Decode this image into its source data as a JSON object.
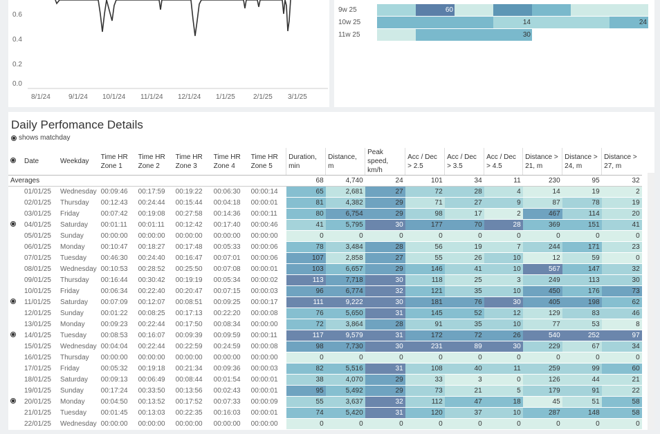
{
  "line_chart": {
    "y_ticks": [
      "0.6",
      "0.4",
      "0.2",
      "0.0"
    ],
    "x_ticks": [
      "8/1/24",
      "9/1/24",
      "10/1/24",
      "11/1/24",
      "12/1/24",
      "1/1/25",
      "2/1/25",
      "3/1/25"
    ]
  },
  "heatmap": {
    "rows": [
      {
        "label": "9w 25",
        "cells": [
          {
            "v": "",
            "c": "#a7d7dc"
          },
          {
            "v": "60",
            "c": "#5b7fa8",
            "w": true
          },
          {
            "v": "",
            "c": "#cfeae6"
          },
          {
            "v": "",
            "c": "#5d96b5"
          },
          {
            "v": "",
            "c": "#7ab9cc"
          },
          {
            "v": "",
            "c": "#cfeae6"
          },
          {
            "v": "",
            "c": "#cfeae6"
          }
        ]
      },
      {
        "label": "10w 25",
        "cells": [
          {
            "v": "",
            "c": "#7ab9cc"
          },
          {
            "v": "",
            "c": "#7ab9cc"
          },
          {
            "v": "",
            "c": "#7ab9cc"
          },
          {
            "v": "14",
            "c": "#a7d7dc"
          },
          {
            "v": "",
            "c": "#a7d7dc"
          },
          {
            "v": "",
            "c": "#a7d7dc"
          },
          {
            "v": "24",
            "c": "#7ab9cc"
          }
        ]
      },
      {
        "label": "11w 25",
        "cells": [
          {
            "v": "",
            "c": "#cfeae6"
          },
          {
            "v": "",
            "c": "#7ab9cc"
          },
          {
            "v": "",
            "c": "#7ab9cc"
          },
          {
            "v": "30",
            "c": "#7ab9cc"
          },
          {
            "v": "",
            "c": "#fff"
          },
          {
            "v": "",
            "c": "#fff"
          },
          {
            "v": "",
            "c": "#fff"
          }
        ]
      }
    ]
  },
  "details": {
    "title": "Daily Perfomance Details",
    "subtitle": "shows matchday",
    "headers": [
      "Date",
      "Weekday",
      "Time HR Zone 1",
      "Time HR Zone 2",
      "Time HR Zone 3",
      "Time HR Zone 4",
      "Time HR Zone 5",
      "Duration, min",
      "Distance, m",
      "Peak speed, km/h",
      "Acc / Dec > 2.5",
      "Acc / Dec > 3.5",
      "Acc / Dec > 4.5",
      "Distance > 21, m",
      "Distance > 24, m",
      "Distance > 27, m"
    ],
    "averages_label": "Averages",
    "averages": [
      "68",
      "4,740",
      "24",
      "101",
      "34",
      "11",
      "230",
      "95",
      "32"
    ],
    "rows": [
      {
        "m": false,
        "d": "01/01/25",
        "w": "Wednesday",
        "z": [
          "00:09:46",
          "00:17:59",
          "00:19:22",
          "00:06:30",
          "00:00:14"
        ],
        "n": [
          "65",
          "2,681",
          "27",
          "72",
          "28",
          "4",
          "14",
          "19",
          "2"
        ]
      },
      {
        "m": false,
        "d": "02/01/25",
        "w": "Thursday",
        "z": [
          "00:12:43",
          "00:24:44",
          "00:15:44",
          "00:04:18",
          "00:00:01"
        ],
        "n": [
          "81",
          "4,382",
          "29",
          "71",
          "27",
          "9",
          "87",
          "78",
          "19"
        ]
      },
      {
        "m": false,
        "d": "03/01/25",
        "w": "Friday",
        "z": [
          "00:07:42",
          "00:19:08",
          "00:27:58",
          "00:14:36",
          "00:00:11"
        ],
        "n": [
          "80",
          "6,754",
          "29",
          "98",
          "17",
          "2",
          "467",
          "114",
          "20"
        ]
      },
      {
        "m": true,
        "d": "04/01/25",
        "w": "Saturday",
        "z": [
          "00:01:11",
          "00:01:11",
          "00:12:42",
          "00:17:40",
          "00:00:46"
        ],
        "n": [
          "41",
          "5,795",
          "30",
          "177",
          "70",
          "28",
          "369",
          "151",
          "41"
        ]
      },
      {
        "m": false,
        "d": "05/01/25",
        "w": "Sunday",
        "z": [
          "00:00:00",
          "00:00:00",
          "00:00:00",
          "00:00:00",
          "00:00:00"
        ],
        "n": [
          "0",
          "0",
          "0",
          "0",
          "0",
          "0",
          "0",
          "0",
          "0"
        ]
      },
      {
        "m": false,
        "d": "06/01/25",
        "w": "Monday",
        "z": [
          "00:10:47",
          "00:18:27",
          "00:17:48",
          "00:05:33",
          "00:00:06"
        ],
        "n": [
          "78",
          "3,484",
          "28",
          "56",
          "19",
          "7",
          "244",
          "171",
          "23"
        ]
      },
      {
        "m": false,
        "d": "07/01/25",
        "w": "Tuesday",
        "z": [
          "00:46:30",
          "00:24:40",
          "00:16:47",
          "00:07:01",
          "00:00:06"
        ],
        "n": [
          "107",
          "2,858",
          "27",
          "55",
          "26",
          "10",
          "12",
          "59",
          "0"
        ]
      },
      {
        "m": false,
        "d": "08/01/25",
        "w": "Wednesday",
        "z": [
          "00:10:53",
          "00:28:52",
          "00:25:50",
          "00:07:08",
          "00:00:01"
        ],
        "n": [
          "103",
          "6,657",
          "29",
          "146",
          "41",
          "10",
          "567",
          "147",
          "32"
        ]
      },
      {
        "m": false,
        "d": "09/01/25",
        "w": "Thursday",
        "z": [
          "00:16:44",
          "00:30:42",
          "00:19:19",
          "00:05:34",
          "00:00:02"
        ],
        "n": [
          "113",
          "7,718",
          "30",
          "118",
          "25",
          "3",
          "249",
          "113",
          "30"
        ]
      },
      {
        "m": false,
        "d": "10/01/25",
        "w": "Friday",
        "z": [
          "00:06:34",
          "00:22:40",
          "00:20:47",
          "00:07:15",
          "00:00:03"
        ],
        "n": [
          "96",
          "6,774",
          "32",
          "121",
          "35",
          "10",
          "450",
          "176",
          "73"
        ]
      },
      {
        "m": true,
        "d": "11/01/25",
        "w": "Saturday",
        "z": [
          "00:07:09",
          "00:12:07",
          "00:08:51",
          "00:09:25",
          "00:00:17"
        ],
        "n": [
          "111",
          "9,222",
          "30",
          "181",
          "76",
          "30",
          "405",
          "198",
          "62"
        ]
      },
      {
        "m": false,
        "d": "12/01/25",
        "w": "Sunday",
        "z": [
          "00:01:22",
          "00:08:25",
          "00:17:13",
          "00:22:20",
          "00:00:08"
        ],
        "n": [
          "76",
          "5,650",
          "31",
          "145",
          "52",
          "12",
          "129",
          "83",
          "46"
        ]
      },
      {
        "m": false,
        "d": "13/01/25",
        "w": "Monday",
        "z": [
          "00:09:23",
          "00:22:44",
          "00:17:50",
          "00:08:34",
          "00:00:00"
        ],
        "n": [
          "72",
          "3,864",
          "28",
          "91",
          "35",
          "10",
          "77",
          "53",
          "8"
        ]
      },
      {
        "m": true,
        "d": "14/01/25",
        "w": "Tuesday",
        "z": [
          "00:08:53",
          "00:16:07",
          "00:09:39",
          "00:09:59",
          "00:00:11"
        ],
        "n": [
          "117",
          "9,579",
          "31",
          "172",
          "72",
          "26",
          "540",
          "252",
          "97"
        ]
      },
      {
        "m": false,
        "d": "15/01/25",
        "w": "Wednesday",
        "z": [
          "00:04:04",
          "00:22:44",
          "00:22:59",
          "00:24:59",
          "00:00:08"
        ],
        "n": [
          "98",
          "7,730",
          "30",
          "231",
          "89",
          "30",
          "229",
          "67",
          "34"
        ]
      },
      {
        "m": false,
        "d": "16/01/25",
        "w": "Thursday",
        "z": [
          "00:00:00",
          "00:00:00",
          "00:00:00",
          "00:00:00",
          "00:00:00"
        ],
        "n": [
          "0",
          "0",
          "0",
          "0",
          "0",
          "0",
          "0",
          "0",
          "0"
        ]
      },
      {
        "m": false,
        "d": "17/01/25",
        "w": "Friday",
        "z": [
          "00:05:32",
          "00:19:18",
          "00:21:34",
          "00:09:36",
          "00:00:03"
        ],
        "n": [
          "82",
          "5,516",
          "31",
          "108",
          "40",
          "11",
          "259",
          "99",
          "60"
        ]
      },
      {
        "m": false,
        "d": "18/01/25",
        "w": "Saturday",
        "z": [
          "00:09:13",
          "00:06:49",
          "00:08:44",
          "00:01:54",
          "00:00:01"
        ],
        "n": [
          "38",
          "4,070",
          "29",
          "33",
          "3",
          "0",
          "126",
          "44",
          "21"
        ]
      },
      {
        "m": false,
        "d": "19/01/25",
        "w": "Sunday",
        "z": [
          "00:17:24",
          "00:33:50",
          "00:13:56",
          "00:02:43",
          "00:00:01"
        ],
        "n": [
          "95",
          "5,492",
          "29",
          "73",
          "21",
          "5",
          "179",
          "91",
          "22"
        ]
      },
      {
        "m": true,
        "d": "20/01/25",
        "w": "Monday",
        "z": [
          "00:04:50",
          "00:13:52",
          "00:17:52",
          "00:07:33",
          "00:00:09"
        ],
        "n": [
          "55",
          "3,637",
          "32",
          "112",
          "47",
          "18",
          "45",
          "51",
          "58"
        ]
      },
      {
        "m": false,
        "d": "21/01/25",
        "w": "Tuesday",
        "z": [
          "00:01:45",
          "00:13:03",
          "00:22:35",
          "00:16:03",
          "00:00:01"
        ],
        "n": [
          "74",
          "5,420",
          "31",
          "120",
          "37",
          "10",
          "287",
          "148",
          "58"
        ]
      },
      {
        "m": false,
        "d": "22/01/25",
        "w": "Wednesday",
        "z": [
          "00:00:00",
          "00:00:00",
          "00:00:00",
          "00:00:00",
          "00:00:00"
        ],
        "n": [
          "0",
          "0",
          "0",
          "0",
          "0",
          "0",
          "0",
          "0",
          "0"
        ]
      }
    ]
  }
}
